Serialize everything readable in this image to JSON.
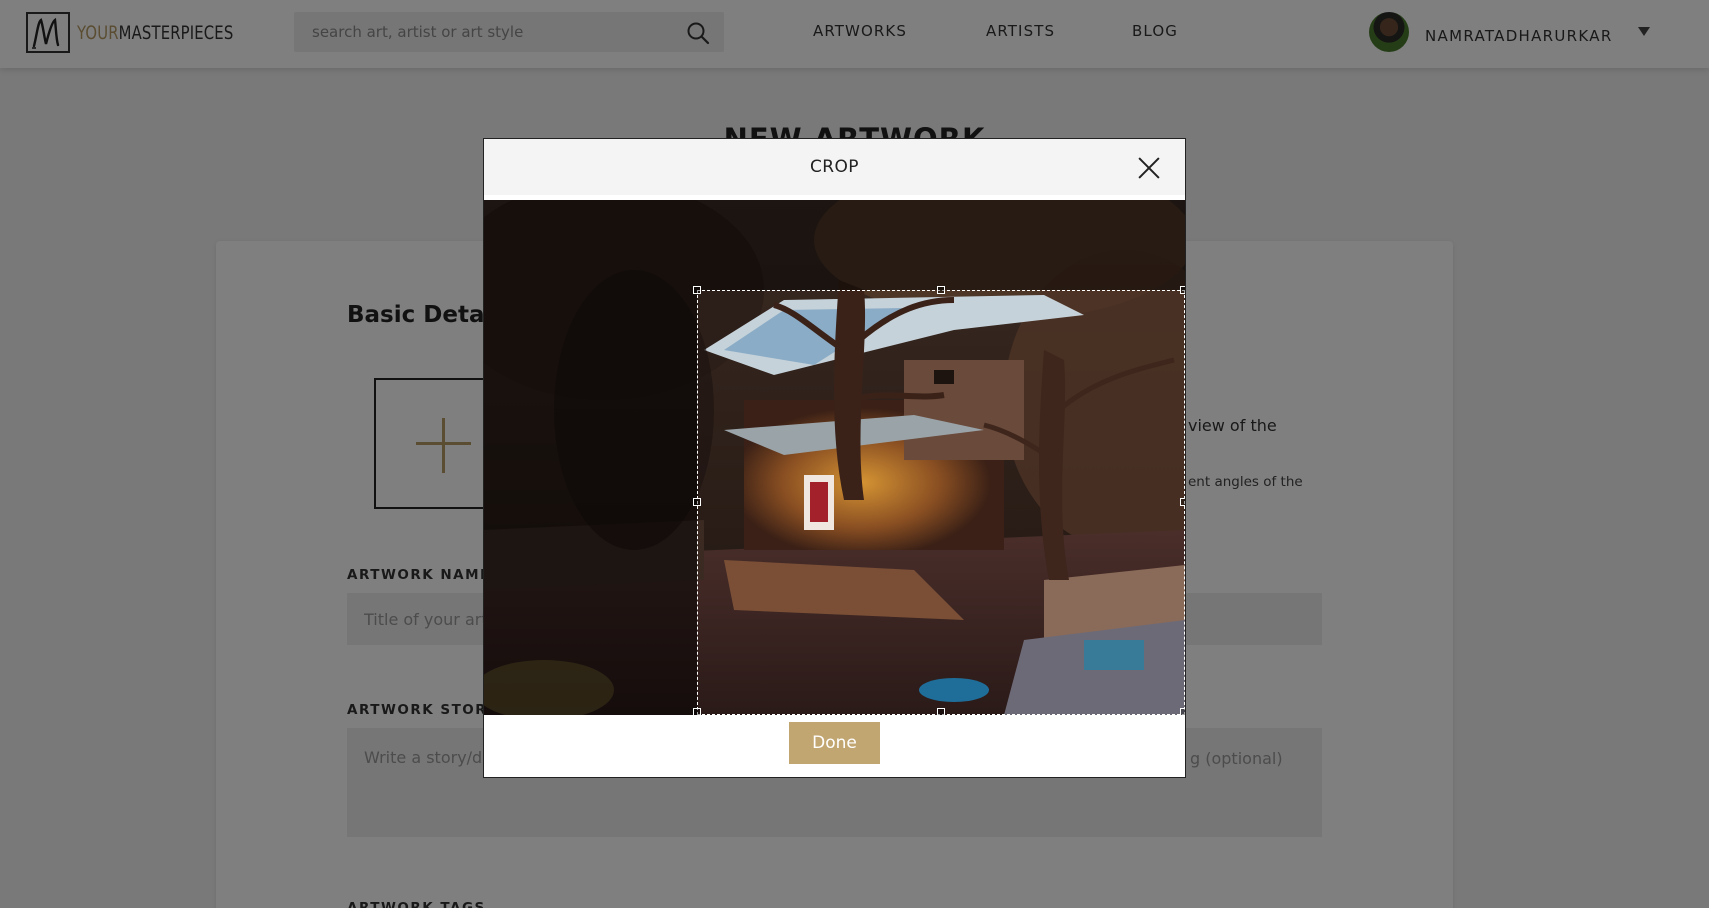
{
  "header": {
    "logo": {
      "prefix": "YOUR",
      "suffix": "MASTERPIECES",
      "mark": "M",
      "accent_color": "#b59a64"
    },
    "search": {
      "placeholder": "search art, artist or art style",
      "icon": "search-icon"
    },
    "nav": {
      "artworks": "ARTWORKS",
      "artists": "ARTISTS",
      "blog": "BLOG"
    },
    "user": {
      "name": "NAMRATADHARURKAR",
      "menu_icon": "chevron-down-icon"
    }
  },
  "page": {
    "title": "NEW ARTWORK",
    "section_title": "Basic Details",
    "upload_icon": "plus-icon",
    "side_text_1": "view of the",
    "side_text_2": "ent angles of the",
    "fields": {
      "name_label": "ARTWORK NAME",
      "name_placeholder": "Title of your art",
      "story_label": "ARTWORK STORY",
      "story_placeholder": "Write a story/de",
      "story_optional": "g (optional)",
      "tags_label": "ARTWORK TAGS"
    }
  },
  "modal": {
    "title": "CROP",
    "close_icon": "close-icon",
    "done_label": "Done",
    "button_color": "#c2a672"
  }
}
